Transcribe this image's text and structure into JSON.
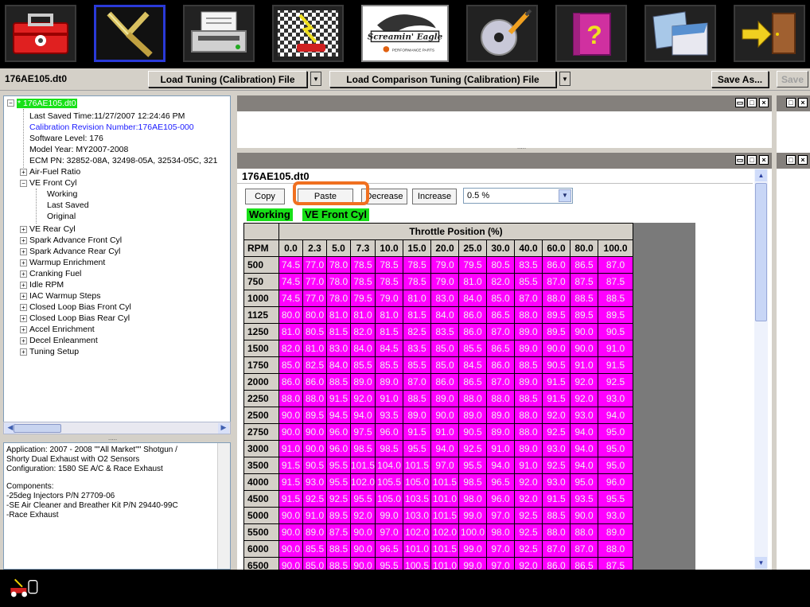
{
  "toolbar": {
    "items": [
      {
        "name": "toolbox-icon"
      },
      {
        "name": "tuning-fork-icon"
      },
      {
        "name": "printer-icon"
      },
      {
        "name": "race-flag-icon"
      },
      {
        "name": "logo"
      },
      {
        "name": "disc-icon"
      },
      {
        "name": "help-book-icon"
      },
      {
        "name": "pages-icon"
      },
      {
        "name": "exit-door-icon"
      }
    ],
    "logo_text": "Screamin' Eagle",
    "logo_sub": "PERFORMANCE PARTS"
  },
  "filebar": {
    "filename": "176AE105.dt0",
    "load_tuning": "Load Tuning (Calibration) File",
    "load_comparison": "Load Comparison Tuning (Calibration) File",
    "save_as": "Save As...",
    "save": "Save"
  },
  "tree": {
    "root": "* 176AE105.dt0",
    "root_children": [
      "Last Saved Time:11/27/2007 12:24:46 PM",
      "Calibration Revision Number:176AE105-000",
      "Software Level: 176",
      "Model Year: MY2007-2008",
      "ECM PN: 32852-08A, 32498-05A, 32534-05C, 321"
    ],
    "air_fuel": "Air-Fuel Ratio",
    "ve_front": "VE Front Cyl",
    "ve_front_children": [
      "Working",
      "Last Saved",
      "Original"
    ],
    "rest": [
      "VE Rear Cyl",
      "Spark Advance Front Cyl",
      "Spark Advance Rear Cyl",
      "Warmup Enrichment",
      "Cranking Fuel",
      "Idle RPM",
      "IAC Warmup Steps",
      "Closed Loop Bias Front Cyl",
      "Closed Loop Bias Rear Cyl",
      "Accel Enrichment",
      "Decel Enleanment",
      "Tuning Setup"
    ],
    "splitter_dots": "....."
  },
  "info": {
    "lines": [
      "Application: 2007 - 2008 \"\"All Market\"\" Shotgun /",
      "Shorty Dual Exhaust with O2 Sensors",
      "Configuration: 1580 SE A/C & Race Exhaust",
      "",
      "Components:",
      " -25deg Injectors P/N 27709-06",
      " -SE Air Cleaner and Breather Kit P/N 29440-99C",
      " -Race Exhaust"
    ]
  },
  "panel_dots": ".....",
  "main": {
    "title": "176AE105.dt0",
    "copy": "Copy",
    "paste": "Paste",
    "decrease": "Decrease",
    "increase": "Increase",
    "step": "0.5 %",
    "tag_working": "Working",
    "tag_table": "VE Front Cyl",
    "grid": {
      "title": "Throttle Position (%)",
      "corner": "RPM",
      "columns": [
        "0.0",
        "2.3",
        "5.0",
        "7.3",
        "10.0",
        "15.0",
        "20.0",
        "25.0",
        "30.0",
        "40.0",
        "60.0",
        "80.0",
        "100.0"
      ],
      "rows": [
        {
          "rpm": "500",
          "values": [
            "74.5",
            "77.0",
            "78.0",
            "78.5",
            "78.5",
            "78.5",
            "79.0",
            "79.5",
            "80.5",
            "83.5",
            "86.0",
            "86.5",
            "87.0"
          ]
        },
        {
          "rpm": "750",
          "values": [
            "74.5",
            "77.0",
            "78.0",
            "78.5",
            "78.5",
            "78.5",
            "79.0",
            "81.0",
            "82.0",
            "85.5",
            "87.0",
            "87.5",
            "87.5"
          ]
        },
        {
          "rpm": "1000",
          "values": [
            "74.5",
            "77.0",
            "78.0",
            "79.5",
            "79.0",
            "81.0",
            "83.0",
            "84.0",
            "85.0",
            "87.0",
            "88.0",
            "88.5",
            "88.5"
          ]
        },
        {
          "rpm": "1125",
          "values": [
            "80.0",
            "80.0",
            "81.0",
            "81.0",
            "81.0",
            "81.5",
            "84.0",
            "86.0",
            "86.5",
            "88.0",
            "89.5",
            "89.5",
            "89.5"
          ]
        },
        {
          "rpm": "1250",
          "values": [
            "81.0",
            "80.5",
            "81.5",
            "82.0",
            "81.5",
            "82.5",
            "83.5",
            "86.0",
            "87.0",
            "89.0",
            "89.5",
            "90.0",
            "90.5"
          ]
        },
        {
          "rpm": "1500",
          "values": [
            "82.0",
            "81.0",
            "83.0",
            "84.0",
            "84.5",
            "83.5",
            "85.0",
            "85.5",
            "86.5",
            "89.0",
            "90.0",
            "90.0",
            "91.0"
          ]
        },
        {
          "rpm": "1750",
          "values": [
            "85.0",
            "82.5",
            "84.0",
            "85.5",
            "85.5",
            "85.5",
            "85.0",
            "84.5",
            "86.0",
            "88.5",
            "90.5",
            "91.0",
            "91.5"
          ]
        },
        {
          "rpm": "2000",
          "values": [
            "86.0",
            "86.0",
            "88.5",
            "89.0",
            "89.0",
            "87.0",
            "86.0",
            "86.5",
            "87.0",
            "89.0",
            "91.5",
            "92.0",
            "92.5"
          ]
        },
        {
          "rpm": "2250",
          "values": [
            "88.0",
            "88.0",
            "91.5",
            "92.0",
            "91.0",
            "88.5",
            "89.0",
            "88.0",
            "88.0",
            "88.5",
            "91.5",
            "92.0",
            "93.0"
          ]
        },
        {
          "rpm": "2500",
          "values": [
            "90.0",
            "89.5",
            "94.5",
            "94.0",
            "93.5",
            "89.0",
            "90.0",
            "89.0",
            "89.0",
            "88.0",
            "92.0",
            "93.0",
            "94.0"
          ]
        },
        {
          "rpm": "2750",
          "values": [
            "90.0",
            "90.0",
            "96.0",
            "97.5",
            "96.0",
            "91.5",
            "91.0",
            "90.5",
            "89.0",
            "88.0",
            "92.5",
            "94.0",
            "95.0"
          ]
        },
        {
          "rpm": "3000",
          "values": [
            "91.0",
            "90.0",
            "96.0",
            "98.5",
            "98.5",
            "95.5",
            "94.0",
            "92.5",
            "91.0",
            "89.0",
            "93.0",
            "94.0",
            "95.0"
          ]
        },
        {
          "rpm": "3500",
          "values": [
            "91.5",
            "90.5",
            "95.5",
            "101.5",
            "104.0",
            "101.5",
            "97.0",
            "95.5",
            "94.0",
            "91.0",
            "92.5",
            "94.0",
            "95.0"
          ]
        },
        {
          "rpm": "4000",
          "values": [
            "91.5",
            "93.0",
            "95.5",
            "102.0",
            "105.5",
            "105.0",
            "101.5",
            "98.5",
            "96.5",
            "92.0",
            "93.0",
            "95.0",
            "96.0"
          ]
        },
        {
          "rpm": "4500",
          "values": [
            "91.5",
            "92.5",
            "92.5",
            "95.5",
            "105.0",
            "103.5",
            "101.0",
            "98.0",
            "96.0",
            "92.0",
            "91.5",
            "93.5",
            "95.5"
          ]
        },
        {
          "rpm": "5000",
          "values": [
            "90.0",
            "91.0",
            "89.5",
            "92.0",
            "99.0",
            "103.0",
            "101.5",
            "99.0",
            "97.0",
            "92.5",
            "88.5",
            "90.0",
            "93.0"
          ]
        },
        {
          "rpm": "5500",
          "values": [
            "90.0",
            "89.0",
            "87.5",
            "90.0",
            "97.0",
            "102.0",
            "102.0",
            "100.0",
            "98.0",
            "92.5",
            "88.0",
            "88.0",
            "89.0"
          ]
        },
        {
          "rpm": "6000",
          "values": [
            "90.0",
            "85.5",
            "88.5",
            "90.0",
            "96.5",
            "101.0",
            "101.5",
            "99.0",
            "97.0",
            "92.5",
            "87.0",
            "87.0",
            "88.0"
          ]
        },
        {
          "rpm": "6500",
          "values": [
            "90.0",
            "85.0",
            "88.5",
            "90.0",
            "95.5",
            "100.5",
            "101.0",
            "99.0",
            "97.0",
            "92.0",
            "86.0",
            "86.5",
            "87.5"
          ]
        }
      ]
    }
  },
  "colors": {
    "accent_green": "#18e018",
    "cell_magenta": "#ff00ff",
    "highlight_orange": "#f07020",
    "tree_blue": "#1a1aff"
  }
}
